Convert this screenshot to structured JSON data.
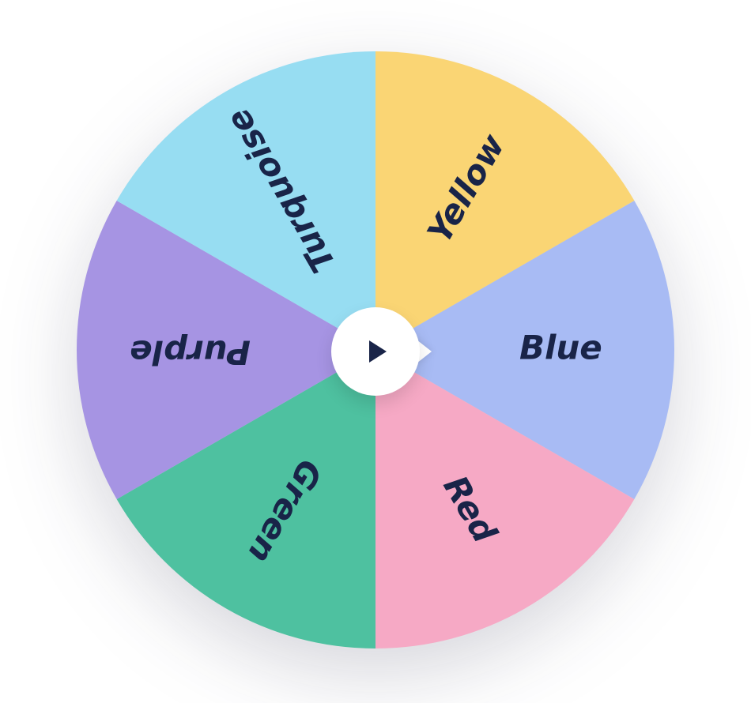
{
  "chart_data": {
    "type": "pie",
    "title": "",
    "series": [
      {
        "name": "Blue",
        "value": 1,
        "color": "#A8BBF4"
      },
      {
        "name": "Red",
        "value": 1,
        "color": "#F6A9C5"
      },
      {
        "name": "Green",
        "value": 1,
        "color": "#4EC1A0"
      },
      {
        "name": "Purple",
        "value": 1,
        "color": "#A694E3"
      },
      {
        "name": "Turquoise",
        "value": 1,
        "color": "#97DDF2"
      },
      {
        "name": "Yellow",
        "value": 1,
        "color": "#FAD574"
      }
    ],
    "start_angle": -30,
    "label_color": "#192448",
    "hub_icon": "play"
  }
}
